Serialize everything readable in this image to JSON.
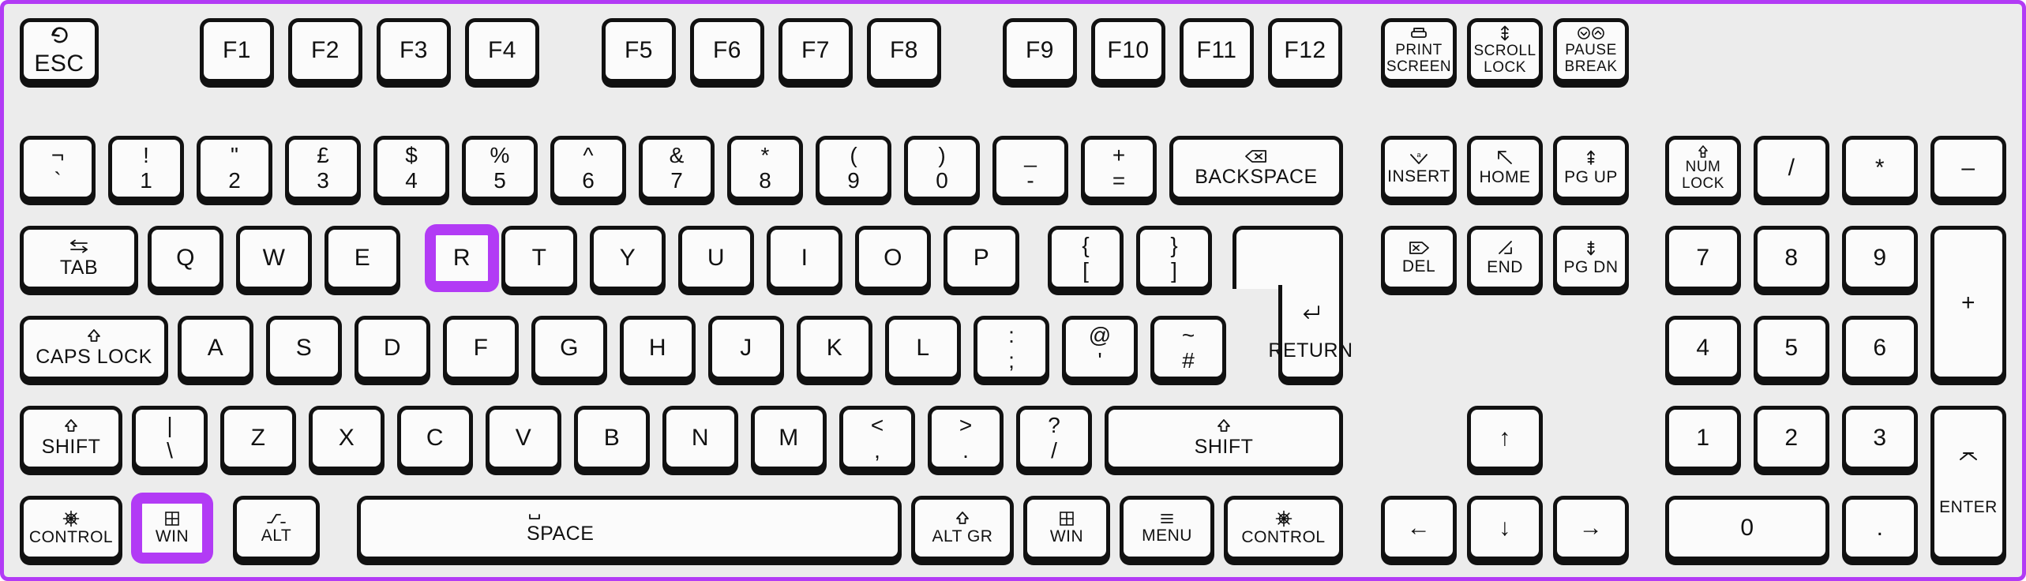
{
  "meta": {
    "device": "keyboard",
    "layout": "UK (ISO) full-size 104-key with numeric keypad",
    "background_color": "#ececec",
    "key_face_color": "#fbfbfb",
    "key_outline_color": "#111111",
    "highlight_color": "#b23bf5",
    "highlighted_keys": [
      "R",
      "WIN"
    ]
  },
  "keys": {
    "esc": {
      "label": "ESC",
      "icon": "escape-loop-icon"
    },
    "f1": {
      "label": "F1"
    },
    "f2": {
      "label": "F2"
    },
    "f3": {
      "label": "F3"
    },
    "f4": {
      "label": "F4"
    },
    "f5": {
      "label": "F5"
    },
    "f6": {
      "label": "F6"
    },
    "f7": {
      "label": "F7"
    },
    "f8": {
      "label": "F8"
    },
    "f9": {
      "label": "F9"
    },
    "f10": {
      "label": "F10"
    },
    "f11": {
      "label": "F11"
    },
    "f12": {
      "label": "F12"
    },
    "print_screen": {
      "label_line1": "PRINT",
      "label_line2": "SCREEN",
      "icon": "printer-icon"
    },
    "scroll_lock": {
      "label_line1": "SCROLL",
      "label_line2": "LOCK",
      "icon": "up-down-arrow-icon"
    },
    "pause_break": {
      "label_line1": "PAUSE",
      "label_line2": "BREAK",
      "icon": "pause-break-circles-icon"
    },
    "backtick": {
      "top": "¬",
      "bottom": "`"
    },
    "one": {
      "top": "!",
      "bottom": "1"
    },
    "two": {
      "top": "\"",
      "bottom": "2"
    },
    "three": {
      "top": "£",
      "bottom": "3"
    },
    "four": {
      "top": "$",
      "bottom": "4"
    },
    "five": {
      "top": "%",
      "bottom": "5"
    },
    "six": {
      "top": "^",
      "bottom": "6"
    },
    "seven": {
      "top": "&",
      "bottom": "7"
    },
    "eight": {
      "top": "*",
      "bottom": "8"
    },
    "nine": {
      "top": "(",
      "bottom": "9"
    },
    "zero": {
      "top": ")",
      "bottom": "0"
    },
    "minus": {
      "top": "_",
      "bottom": "-"
    },
    "equals": {
      "top": "+",
      "bottom": "="
    },
    "backspace": {
      "label": "BACKSPACE",
      "icon": "backspace-icon"
    },
    "insert": {
      "label": "INSERT",
      "icon": "insert-icon"
    },
    "home": {
      "label": "HOME",
      "icon": "arrow-up-left-icon"
    },
    "page_up": {
      "label": "PG UP",
      "icon": "page-up-icon"
    },
    "num_lock": {
      "label_line1": "NUM",
      "label_line2": "LOCK",
      "icon": "num-lock-arrow-icon"
    },
    "np_divide": {
      "label": "/"
    },
    "np_multiply": {
      "label": "*"
    },
    "np_minus": {
      "label": "–"
    },
    "tab": {
      "label": "TAB",
      "icon": "tab-arrows-icon"
    },
    "q": {
      "label": "Q"
    },
    "w": {
      "label": "W"
    },
    "e": {
      "label": "E"
    },
    "r": {
      "label": "R",
      "highlighted": true
    },
    "t": {
      "label": "T"
    },
    "y": {
      "label": "Y"
    },
    "u": {
      "label": "U"
    },
    "i": {
      "label": "I"
    },
    "o": {
      "label": "O"
    },
    "p": {
      "label": "P"
    },
    "bracket_left": {
      "top": "{",
      "bottom": "["
    },
    "bracket_right": {
      "top": "}",
      "bottom": "]"
    },
    "return": {
      "label": "RETURN",
      "icon": "enter-arrow-icon"
    },
    "delete": {
      "label": "DEL",
      "icon": "delete-icon"
    },
    "end": {
      "label": "END",
      "icon": "arrow-down-right-icon"
    },
    "page_down": {
      "label": "PG DN",
      "icon": "page-down-icon"
    },
    "np_7": {
      "label": "7"
    },
    "np_8": {
      "label": "8"
    },
    "np_9": {
      "label": "9"
    },
    "np_plus": {
      "label": "+"
    },
    "caps_lock": {
      "label": "CAPS LOCK",
      "icon": "caps-lock-arrow-icon"
    },
    "a": {
      "label": "A"
    },
    "s": {
      "label": "S"
    },
    "d": {
      "label": "D"
    },
    "f": {
      "label": "F"
    },
    "g": {
      "label": "G"
    },
    "h": {
      "label": "H"
    },
    "j": {
      "label": "J"
    },
    "k": {
      "label": "K"
    },
    "l": {
      "label": "L"
    },
    "semicolon": {
      "top": ":",
      "bottom": ";"
    },
    "apostrophe": {
      "top": "@",
      "bottom": "'"
    },
    "hash": {
      "top": "~",
      "bottom": "#"
    },
    "np_4": {
      "label": "4"
    },
    "np_5": {
      "label": "5"
    },
    "np_6": {
      "label": "6"
    },
    "shift_left": {
      "label": "SHIFT",
      "icon": "shift-arrow-icon"
    },
    "backslash": {
      "top": "|",
      "bottom": "\\"
    },
    "z": {
      "label": "Z"
    },
    "x": {
      "label": "X"
    },
    "c": {
      "label": "C"
    },
    "v": {
      "label": "V"
    },
    "b": {
      "label": "B"
    },
    "n": {
      "label": "N"
    },
    "m": {
      "label": "M"
    },
    "comma": {
      "top": "<",
      "bottom": ","
    },
    "period": {
      "top": ">",
      "bottom": "."
    },
    "slash": {
      "top": "?",
      "bottom": "/"
    },
    "shift_right": {
      "label": "SHIFT",
      "icon": "shift-arrow-icon"
    },
    "arrow_up": {
      "label": "↑"
    },
    "np_1": {
      "label": "1"
    },
    "np_2": {
      "label": "2"
    },
    "np_3": {
      "label": "3"
    },
    "control_left": {
      "label": "CONTROL",
      "icon": "ships-wheel-icon"
    },
    "win_left": {
      "label": "WIN",
      "icon": "windows-grid-icon",
      "highlighted": true
    },
    "alt_left": {
      "label": "ALT",
      "icon": "alt-step-icon"
    },
    "space": {
      "label": "SPACE",
      "icon": "space-bar-icon"
    },
    "alt_gr": {
      "label": "ALT GR",
      "icon": "altgr-arrow-icon"
    },
    "win_right": {
      "label": "WIN",
      "icon": "windows-grid-icon"
    },
    "menu": {
      "label": "MENU",
      "icon": "hamburger-menu-icon"
    },
    "control_right": {
      "label": "CONTROL",
      "icon": "ships-wheel-icon"
    },
    "arrow_left": {
      "label": "←"
    },
    "arrow_down": {
      "label": "↓"
    },
    "arrow_right": {
      "label": "→"
    },
    "np_0": {
      "label": "0"
    },
    "np_period": {
      "label": "."
    },
    "np_enter": {
      "label": "ENTER",
      "icon": "enter-chevron-icon"
    }
  }
}
